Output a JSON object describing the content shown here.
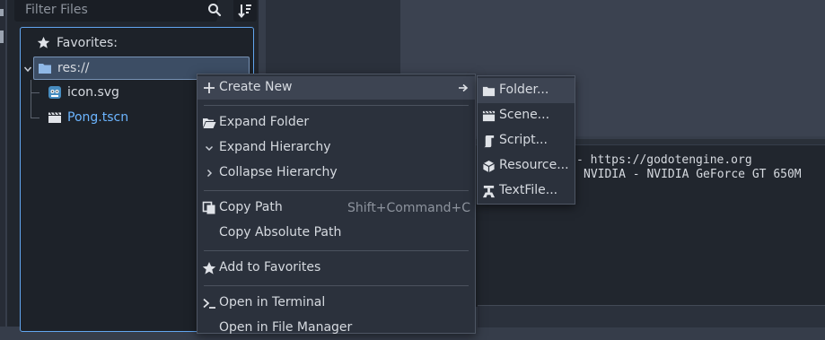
{
  "filesystem": {
    "filter_placeholder": "Filter Files",
    "favorites_label": "Favorites:",
    "items": [
      {
        "label": "res://",
        "icon": "folder-icon"
      },
      {
        "label": "icon.svg",
        "icon": "godot-icon"
      },
      {
        "label": "Pong.tscn",
        "icon": "clapperboard-icon",
        "color": "#6cb5ff"
      }
    ]
  },
  "output": {
    "lines": [
      "- https://godotengine.org",
      "NVIDIA - NVIDIA GeForce GT 650M"
    ]
  },
  "context_menu": {
    "create_new": "Create New",
    "expand_folder": "Expand Folder",
    "expand_hierarchy": "Expand Hierarchy",
    "collapse_hierarchy": "Collapse Hierarchy",
    "copy_path": "Copy Path",
    "copy_path_shortcut": "Shift+Command+C",
    "copy_absolute_path": "Copy Absolute Path",
    "add_to_favorites": "Add to Favorites",
    "open_in_terminal": "Open in Terminal",
    "open_in_file_manager": "Open in File Manager"
  },
  "submenu": {
    "folder": "Folder...",
    "scene": "Scene...",
    "script": "Script...",
    "resource": "Resource...",
    "textfile": "TextFile..."
  },
  "colors": {
    "selection_border": "#62a6f0",
    "scene_file": "#6cb5ff",
    "folder": "#8fb8e6"
  }
}
